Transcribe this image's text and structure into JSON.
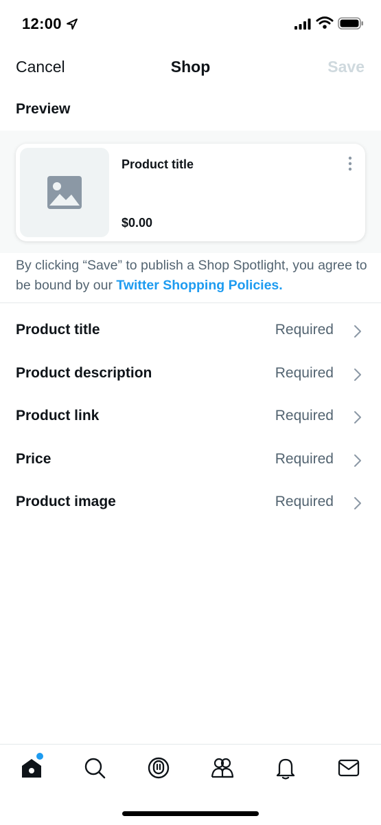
{
  "status_bar": {
    "time": "12:00"
  },
  "header": {
    "cancel_label": "Cancel",
    "title": "Shop",
    "save_label": "Save"
  },
  "preview": {
    "label": "Preview",
    "card": {
      "title": "Product title",
      "price": "$0.00"
    }
  },
  "disclaimer": {
    "text": "By clicking “Save” to publish a Shop Spotlight, you agree to be bound by our ",
    "link": "Twitter Shopping Policies."
  },
  "fields": [
    {
      "label": "Product title",
      "value": "Required"
    },
    {
      "label": "Product description",
      "value": "Required"
    },
    {
      "label": "Product link",
      "value": "Required"
    },
    {
      "label": "Price",
      "value": "Required"
    },
    {
      "label": "Product image",
      "value": "Required"
    }
  ],
  "tab_bar": {
    "tabs": [
      "home-icon",
      "search-icon",
      "spaces-icon",
      "communities-icon",
      "notifications-icon",
      "messages-icon"
    ]
  },
  "colors": {
    "accent": "#1d9bf0",
    "muted": "#536471",
    "disabled": "#cfd9de"
  }
}
